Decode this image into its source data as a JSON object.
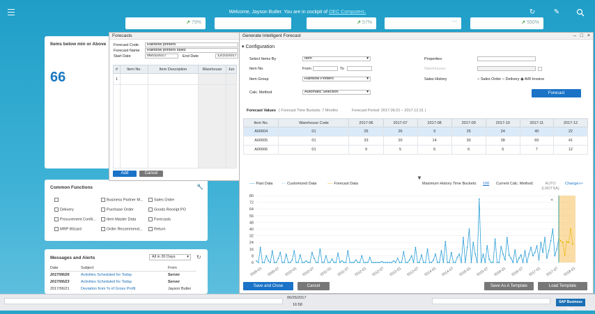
{
  "header": {
    "welcome_prefix": "Welcome, Jayson Butler. You are in cockpit of ",
    "company": "OEC Computers.",
    "kpis": [
      "79%",
      "",
      "57%",
      "---",
      "550%"
    ]
  },
  "widgets": {
    "items_below": {
      "title": "Items below min or Above",
      "value": "66"
    },
    "common_functions": {
      "title": "Common Functions",
      "items": [
        "Business Partner M...",
        "Sales Order",
        "Delivery",
        "Purchase Order",
        "Goods Receipt PO",
        "Procurement Confir...",
        "Item Master Data",
        "Forecasts",
        "MRP Wizard",
        "Order Recommend...",
        "Return"
      ]
    },
    "messages": {
      "title": "Messages and Alerts",
      "filter": "All in 30 Days",
      "columns": [
        "Date",
        "Subject",
        "From"
      ],
      "rows": [
        {
          "date": "2017/06/26",
          "subject": "Activities Scheduled for Today",
          "from": "Server"
        },
        {
          "date": "2017/06/23",
          "subject": "Activities Scheduled for Today",
          "from": "Server"
        },
        {
          "date": "2017/06/21",
          "subject": "Deviation from % of Gross Profit",
          "from": "Jayson Butler"
        }
      ]
    }
  },
  "forecasts_window": {
    "title": "Forecasts",
    "forecast_code_label": "Forecast Code",
    "forecast_code": "Rainbow printers",
    "forecast_name_label": "Forecast Name",
    "forecast_name": "Rainbow printers sales",
    "start_date_label": "Start Date",
    "start_date": "06/01/2017",
    "end_date_label": "End Date",
    "end_date": "12/31/2017",
    "columns": [
      "#",
      "Item No.",
      "Item Description",
      "Warehouse",
      "Jun"
    ],
    "row_number": "1",
    "add_label": "Add",
    "cancel_label": "Cancel"
  },
  "gif_window": {
    "title": "Generate Intelligent Forecast",
    "configuration_label": "Configuration",
    "select_items_by_label": "Select Items By",
    "select_items_by": "Item",
    "item_no_label": "Item No.",
    "from_label": "From",
    "to_label": "To",
    "item_group_label": "Item Group",
    "item_group": "Rainbow Printers",
    "calc_method_label": "Calc. Method",
    "calc_method": "Automatic Selection",
    "properties_label": "Properties",
    "warehouses_label": "Warehouses",
    "sales_history_label": "Sales History",
    "sales_history_options": [
      "Sales Order",
      "Delivery",
      "A/R Invoice"
    ],
    "forecast_button": "Forecast",
    "forecast_values_label": "Forecast Values",
    "forecast_buckets": "( Forecast Time Buckets: 7 Months",
    "forecast_period": "Forecast Period: 2017.06.01 – 2017.12.31 )",
    "columns": [
      "Item No.",
      "Warehouse Code",
      "2017-06",
      "2017-07",
      "2017-08",
      "2017-09",
      "2017-10",
      "2017-11",
      "2017-12"
    ],
    "rows": [
      [
        "A00004",
        "01",
        "26",
        "26",
        "9",
        "25",
        "24",
        "40",
        "22"
      ],
      [
        "A00005",
        "01",
        "33",
        "20",
        "14",
        "30",
        "38",
        "60",
        "41"
      ],
      [
        "A00006",
        "01",
        "9",
        "5",
        "6",
        "6",
        "6",
        "7",
        "12"
      ]
    ],
    "max_history_label": "Maximum History Time Buckets:",
    "max_history_value": "100",
    "current_calc_label": "Current Calc. Method:",
    "current_calc_value": "AUTO (LRDTSA)",
    "change_label": "Change>>",
    "save_close": "Save and Close",
    "cancel": "Cancel",
    "save_template": "Save As A Template",
    "load_template": "Load Template"
  },
  "chart_data": {
    "type": "line",
    "series": [
      {
        "name": "Past Data",
        "color": "#2a9fd6"
      },
      {
        "name": "Customized Data",
        "color": "#7fc7e8"
      },
      {
        "name": "Forecast Data",
        "color": "#e8b400"
      }
    ],
    "y_ticks": [
      "80",
      "72",
      "64",
      "56",
      "48",
      "40",
      "32",
      "24",
      "16",
      "8",
      "0"
    ],
    "ylim": [
      0,
      80
    ],
    "x_ticks": [
      "2009-01",
      "2009-07",
      "2010-01",
      "2010-07",
      "2011-01",
      "2011-07",
      "2012-01",
      "2012-07",
      "2013-01",
      "2013-07",
      "2014-01",
      "2014-07",
      "2015-01",
      "2015-07",
      "2016-01",
      "2016-07",
      "2017-01",
      "2017-07",
      "2018-01"
    ],
    "past_values": [
      2,
      0,
      18,
      0,
      0,
      8,
      2,
      0,
      14,
      0,
      0,
      5,
      12,
      0,
      0,
      10,
      0,
      0,
      3,
      14,
      0,
      0,
      9,
      0,
      0,
      2,
      0,
      0,
      12,
      5,
      0,
      0,
      16,
      0,
      0,
      8,
      0,
      0,
      4,
      0,
      0,
      11,
      0,
      2,
      0,
      0,
      14,
      0,
      0,
      0,
      3,
      0,
      0,
      8,
      0,
      0,
      0,
      6,
      0,
      0,
      0,
      0,
      0,
      1,
      0,
      0,
      0,
      0,
      0,
      2,
      0,
      5,
      0,
      0,
      13,
      0,
      0,
      3,
      8,
      0,
      18,
      0,
      0,
      9,
      0,
      0,
      16,
      0,
      0,
      3,
      10,
      0,
      0,
      14,
      0,
      25,
      0,
      0,
      12,
      0,
      0,
      6,
      10,
      0,
      30,
      0,
      18,
      40,
      0,
      24,
      10,
      0,
      76,
      0,
      10,
      0,
      20,
      4,
      0,
      0,
      28,
      0,
      0,
      19,
      10,
      3,
      30,
      9,
      5,
      0,
      15,
      0,
      5,
      9,
      0,
      14,
      0,
      10,
      18,
      8,
      12,
      20,
      3,
      24,
      12,
      30,
      5,
      14,
      26,
      40,
      8,
      16,
      28
    ],
    "forecast_values": [
      26,
      24,
      9,
      25,
      24,
      40,
      22
    ],
    "grid": true,
    "legend": "top-left"
  },
  "taskbar": {
    "date": "06/26/2017",
    "time": "16:58",
    "brand": "SAP Business One"
  }
}
